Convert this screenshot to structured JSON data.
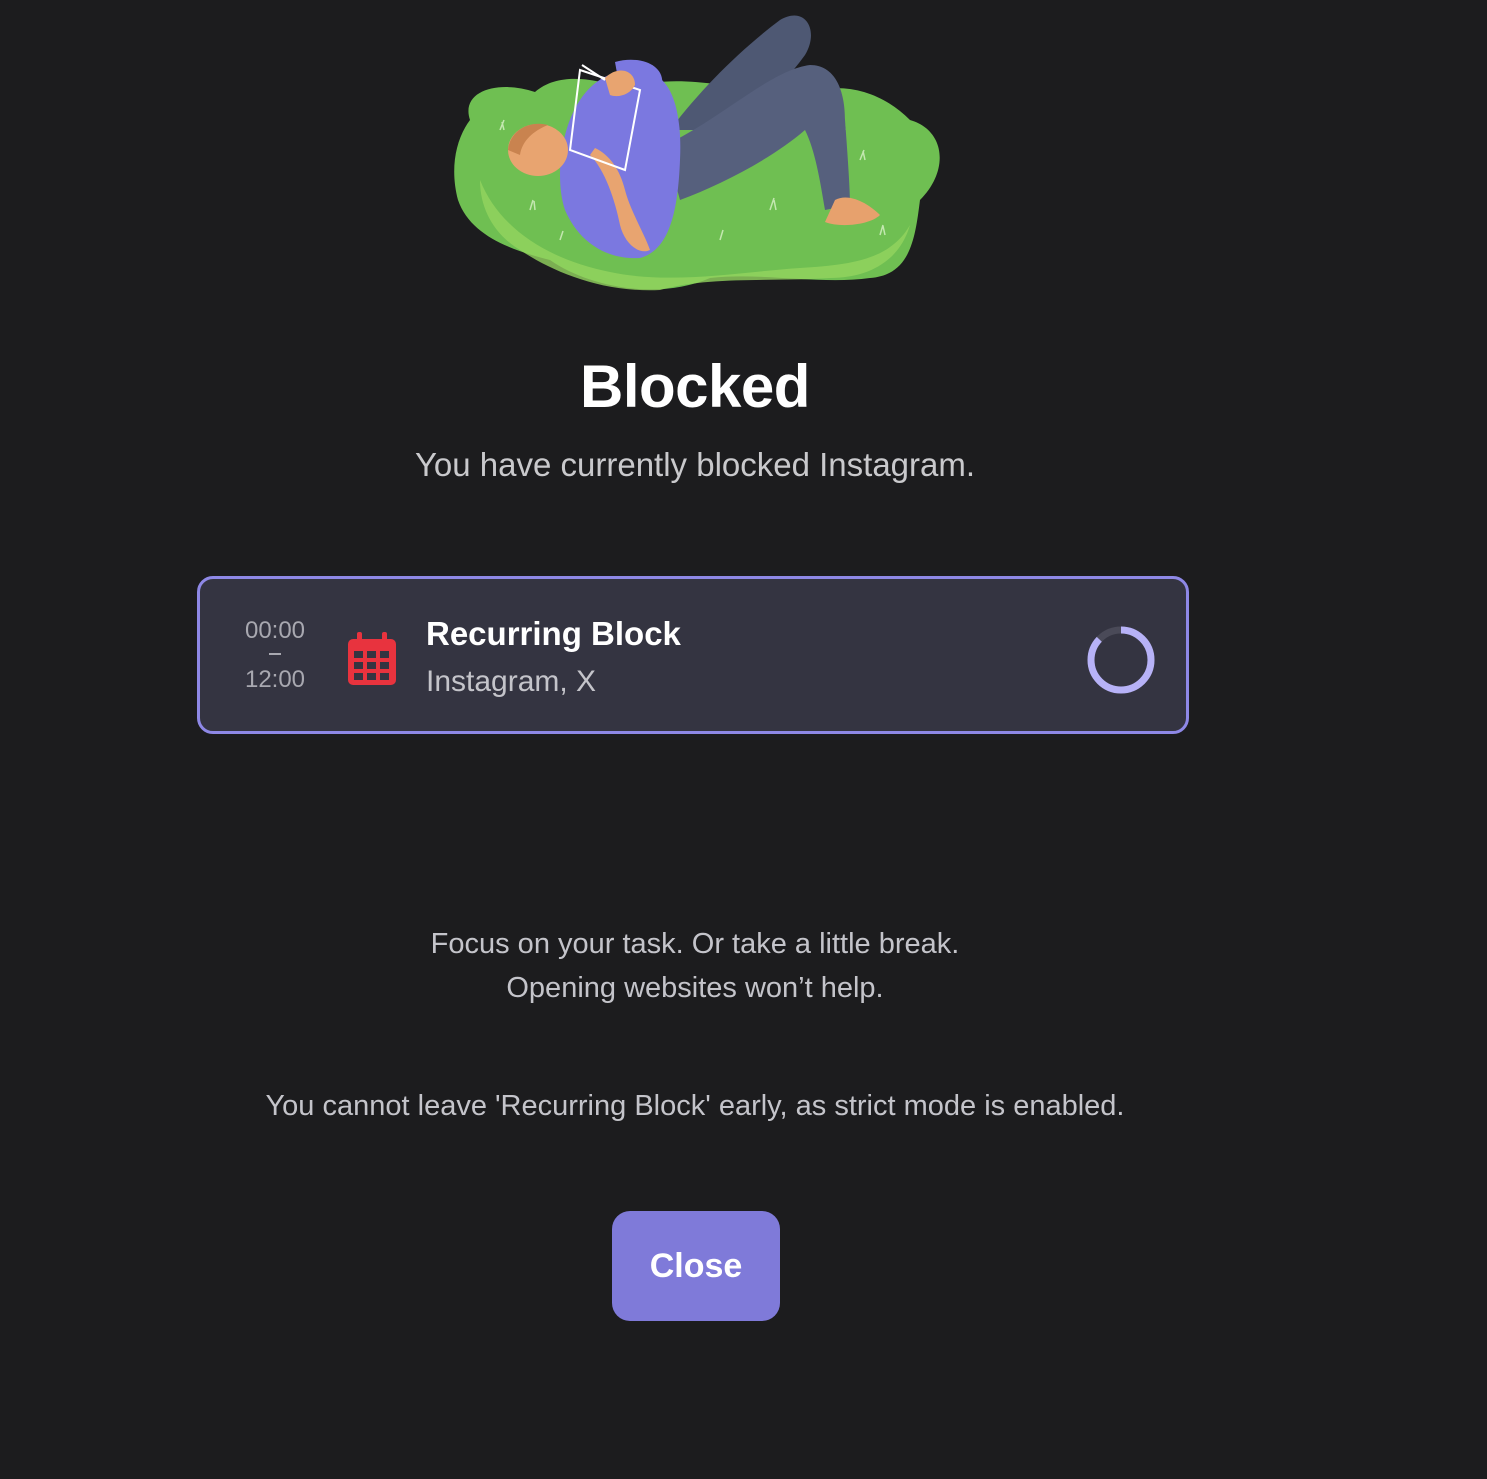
{
  "header": {
    "title": "Blocked",
    "subtitle": "You have currently blocked Instagram."
  },
  "illustration": {
    "icon": "person-resting-on-grass-illustration"
  },
  "block_card": {
    "start_time": "00:00",
    "end_time": "12:00",
    "icon": "calendar-icon",
    "title": "Recurring Block",
    "sites": "Instagram, X",
    "progress_fraction": 0.87,
    "border_color": "#8e88e6",
    "icon_color": "#e8333e",
    "progress_color": "#b7b2f7"
  },
  "message": {
    "line1": "Focus on your task. Or take a little break.",
    "line2": "Opening websites won’t help."
  },
  "strict_notice": "You cannot leave 'Recurring Block' early, as strict mode is enabled.",
  "actions": {
    "close_label": "Close"
  },
  "colors": {
    "background": "#1c1c1e",
    "accent": "#7f7ad9"
  }
}
